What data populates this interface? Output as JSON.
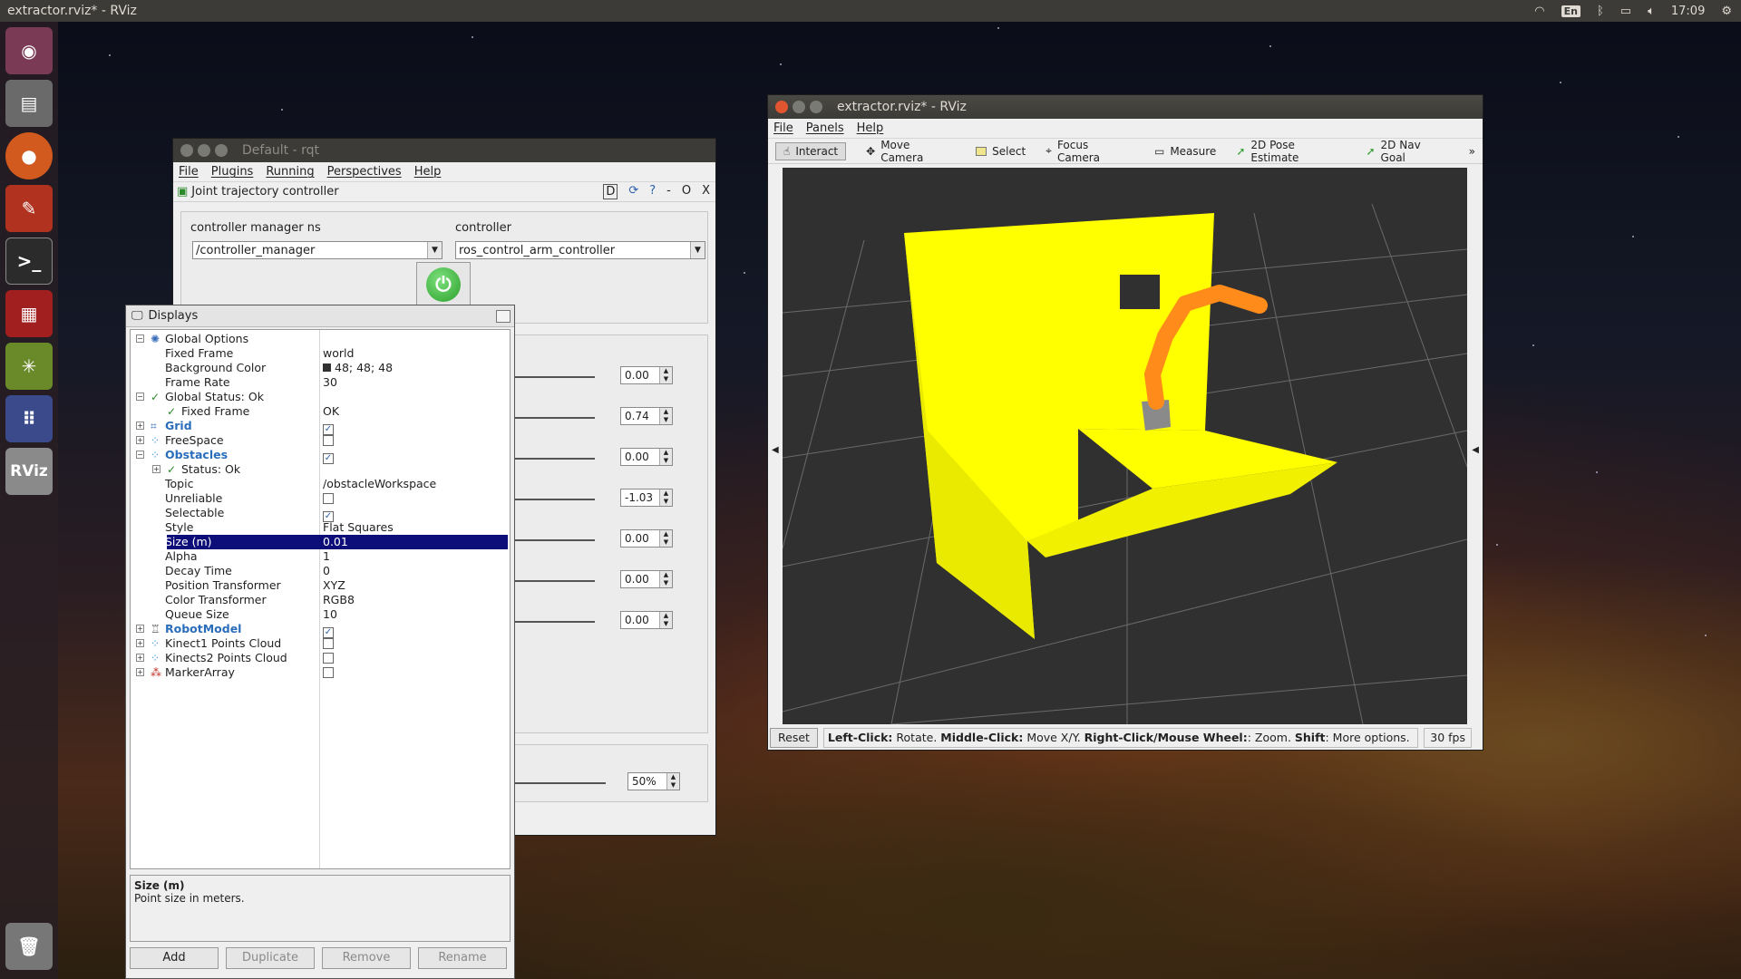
{
  "top_panel": {
    "title": "extractor.rviz* - RViz",
    "keyboard_layout": "En",
    "clock": "17:09"
  },
  "launcher": {
    "items": [
      "ubuntu-logo-icon",
      "files-icon",
      "firefox-icon",
      "settings-icon",
      "terminal-icon",
      "panel-icon",
      "network-icon",
      "apps-grid-icon",
      "rviz-icon",
      "trash-icon"
    ],
    "rviz_label": "RViz"
  },
  "rqt": {
    "title": "Default - rqt",
    "menu": [
      "File",
      "Plugins",
      "Running",
      "Perspectives",
      "Help"
    ],
    "plugin_title": "Joint trajectory controller",
    "plugin_controls": {
      "d": "D",
      "min": "-",
      "o": "O",
      "close": "X"
    },
    "cm_ns_label": "controller manager ns",
    "cm_ns_value": "/controller_manager",
    "controller_label": "controller",
    "controller_value": "ros_control_arm_controller",
    "joint_values": [
      "0.00",
      "0.74",
      "0.00",
      "-1.03",
      "0.00",
      "0.00",
      "0.00"
    ],
    "speed_scaling": "50%"
  },
  "displays": {
    "title": "Displays",
    "rows": [
      {
        "key": "Global Options",
        "value": ""
      },
      {
        "key": "Fixed Frame",
        "value": "world"
      },
      {
        "key": "Background Color",
        "value": "48; 48; 48"
      },
      {
        "key": "Frame Rate",
        "value": "30"
      },
      {
        "key": "Global Status: Ok",
        "value": ""
      },
      {
        "key": "Fixed Frame",
        "value": "OK"
      },
      {
        "key": "Grid",
        "value": ""
      },
      {
        "key": "FreeSpace",
        "value": ""
      },
      {
        "key": "Obstacles",
        "value": ""
      },
      {
        "key": "Status: Ok",
        "value": ""
      },
      {
        "key": "Topic",
        "value": "/obstacleWorkspace"
      },
      {
        "key": "Unreliable",
        "value": ""
      },
      {
        "key": "Selectable",
        "value": ""
      },
      {
        "key": "Style",
        "value": "Flat Squares"
      },
      {
        "key": "Size (m)",
        "value": "0.01"
      },
      {
        "key": "Alpha",
        "value": "1"
      },
      {
        "key": "Decay Time",
        "value": "0"
      },
      {
        "key": "Position Transformer",
        "value": "XYZ"
      },
      {
        "key": "Color Transformer",
        "value": "RGB8"
      },
      {
        "key": "Queue Size",
        "value": "10"
      },
      {
        "key": "RobotModel",
        "value": ""
      },
      {
        "key": "Kinect1 Points Cloud",
        "value": ""
      },
      {
        "key": "Kinects2 Points Cloud",
        "value": ""
      },
      {
        "key": "MarkerArray",
        "value": ""
      }
    ],
    "checkboxes": {
      "grid": true,
      "freespace": false,
      "obstacles": true,
      "unreliable": false,
      "selectable": true,
      "robotmodel": true,
      "kinect1": false,
      "kinect2": false,
      "markerarray": false
    },
    "description_title": "Size (m)",
    "description_text": "Point size in meters.",
    "buttons": [
      "Add",
      "Duplicate",
      "Remove",
      "Rename"
    ],
    "background_swatch": "#303030"
  },
  "rviz": {
    "title": "extractor.rviz* - RViz",
    "menu": [
      "File",
      "Panels",
      "Help"
    ],
    "tools": [
      "Interact",
      "Move Camera",
      "Select",
      "Focus Camera",
      "Measure",
      "2D Pose Estimate",
      "2D Nav Goal"
    ],
    "overflow": "»",
    "reset": "Reset",
    "status_lc": "Left-Click:",
    "status_lc_t": " Rotate. ",
    "status_mc": "Middle-Click:",
    "status_mc_t": " Move X/Y. ",
    "status_rc": "Right-Click/Mouse Wheel:",
    "status_rc_t": ": Zoom. ",
    "status_sh": "Shift",
    "status_sh_t": ": More options.",
    "fps": "30 fps",
    "colors": {
      "obstacle": "#ffff00",
      "robot": "#ff8c1a",
      "viewport_bg": "#303030",
      "grid": "#6a6a6a"
    }
  }
}
